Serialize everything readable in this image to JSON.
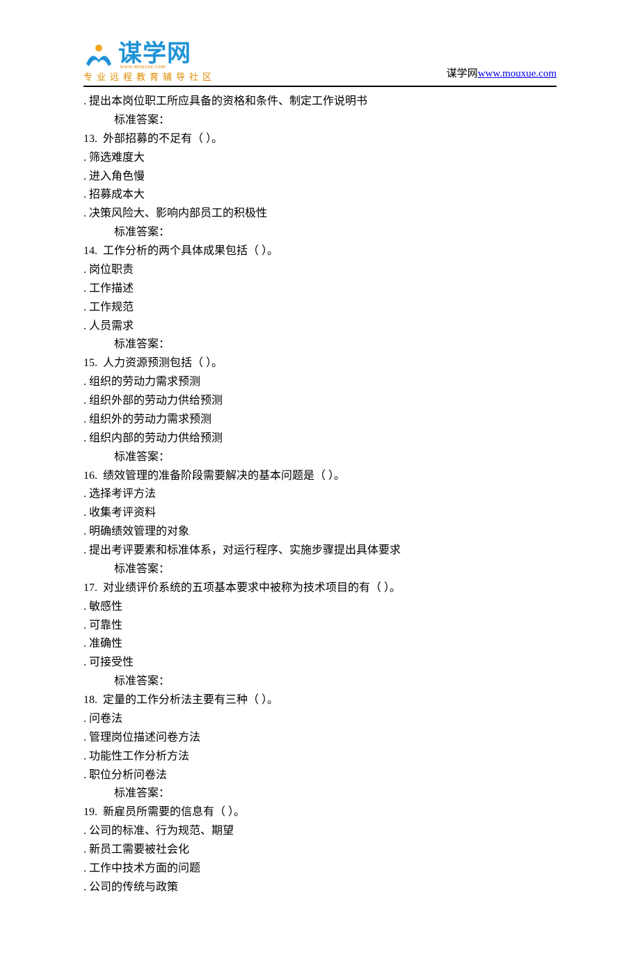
{
  "header": {
    "logo_main": "谋学网",
    "logo_url_small": "www.mouxue.com",
    "logo_sub": "专业远程教育辅导社区",
    "right_prefix": "谋学网",
    "right_link": "www.mouxue.com"
  },
  "lines": [
    {
      "cls": "indent-opt",
      "text": ". 提出本岗位职工所应具备的资格和条件、制定工作说明书"
    },
    {
      "cls": "indent-ans",
      "text": "标准答案："
    },
    {
      "cls": "indent-q",
      "text": "13.  外部招募的不足有（ ）。"
    },
    {
      "cls": "indent-opt",
      "text": ". 筛选难度大"
    },
    {
      "cls": "indent-opt",
      "text": ". 进入角色慢"
    },
    {
      "cls": "indent-opt",
      "text": ". 招募成本大"
    },
    {
      "cls": "indent-opt",
      "text": ". 决策风险大、影响内部员工的积极性"
    },
    {
      "cls": "indent-ans",
      "text": "标准答案："
    },
    {
      "cls": "indent-q",
      "text": "14.  工作分析的两个具体成果包括（ ）。"
    },
    {
      "cls": "indent-opt",
      "text": ". 岗位职责"
    },
    {
      "cls": "indent-opt",
      "text": ". 工作描述"
    },
    {
      "cls": "indent-opt",
      "text": ". 工作规范"
    },
    {
      "cls": "indent-opt",
      "text": ". 人员需求"
    },
    {
      "cls": "indent-ans",
      "text": "标准答案："
    },
    {
      "cls": "indent-q",
      "text": "15.  人力资源预测包括（ ）。"
    },
    {
      "cls": "indent-opt",
      "text": ". 组织的劳动力需求预测"
    },
    {
      "cls": "indent-opt",
      "text": ". 组织外部的劳动力供给预测"
    },
    {
      "cls": "indent-opt",
      "text": ". 组织外的劳动力需求预测"
    },
    {
      "cls": "indent-opt",
      "text": ". 组织内部的劳动力供给预测"
    },
    {
      "cls": "indent-ans",
      "text": "标准答案："
    },
    {
      "cls": "indent-q",
      "text": "16.  绩效管理的准备阶段需要解决的基本问题是（ ）。"
    },
    {
      "cls": "indent-opt",
      "text": ". 选择考评方法"
    },
    {
      "cls": "indent-opt",
      "text": ". 收集考评资料"
    },
    {
      "cls": "indent-opt",
      "text": ". 明确绩效管理的对象"
    },
    {
      "cls": "indent-opt",
      "text": ". 提出考评要素和标准体系，对运行程序、实施步骤提出具体要求"
    },
    {
      "cls": "indent-ans",
      "text": "标准答案："
    },
    {
      "cls": "indent-q",
      "text": "17.  对业绩评价系统的五项基本要求中被称为技术项目的有（ ）。"
    },
    {
      "cls": "indent-opt",
      "text": ". 敏感性"
    },
    {
      "cls": "indent-opt",
      "text": ". 可靠性"
    },
    {
      "cls": "indent-opt",
      "text": ". 准确性"
    },
    {
      "cls": "indent-opt",
      "text": ". 可接受性"
    },
    {
      "cls": "indent-ans",
      "text": "标准答案："
    },
    {
      "cls": "indent-q",
      "text": "18.  定量的工作分析法主要有三种（ ）。"
    },
    {
      "cls": "indent-opt",
      "text": ". 问卷法"
    },
    {
      "cls": "indent-opt",
      "text": ". 管理岗位描述问卷方法"
    },
    {
      "cls": "indent-opt",
      "text": ". 功能性工作分析方法"
    },
    {
      "cls": "indent-opt",
      "text": ". 职位分析问卷法"
    },
    {
      "cls": "indent-ans",
      "text": "标准答案："
    },
    {
      "cls": "indent-q",
      "text": "19.  新雇员所需要的信息有（ ）。"
    },
    {
      "cls": "indent-opt",
      "text": ". 公司的标准、行为规范、期望"
    },
    {
      "cls": "indent-opt",
      "text": ". 新员工需要被社会化"
    },
    {
      "cls": "indent-opt",
      "text": ". 工作中技术方面的问题"
    },
    {
      "cls": "indent-opt",
      "text": ". 公司的传统与政策"
    }
  ]
}
